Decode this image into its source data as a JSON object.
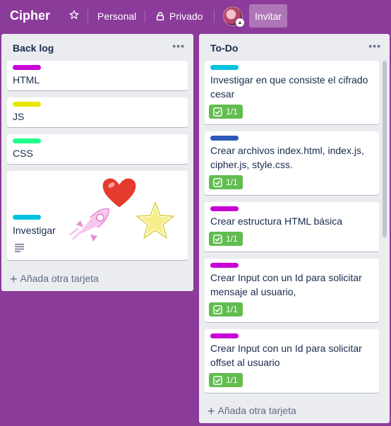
{
  "header": {
    "board_title": "Cipher",
    "star_icon": "star-icon",
    "team": "Personal",
    "visibility": "Privado",
    "invite_label": "Invitar"
  },
  "lists": [
    {
      "title": "Back log",
      "menu": "•••",
      "add_card": "Añada otra tarjeta",
      "cards": [
        {
          "label_color": "#c800d6",
          "text": "HTML"
        },
        {
          "label_color": "#e6e600",
          "text": "JS"
        },
        {
          "label_color": "#1efc8d",
          "text": "CSS"
        },
        {
          "label_color": "#00c2e0",
          "text": "Investigar",
          "stickers": [
            "rocket-sticker",
            "heart-sticker",
            "star-sticker"
          ],
          "has_description": true
        }
      ]
    },
    {
      "title": "To-Do",
      "menu": "•••",
      "add_card": "Añada otra tarjeta",
      "cards": [
        {
          "label_color": "#00c2e0",
          "text_line1": "Investigar en que consiste el cifrado",
          "text_line2": "cesar",
          "checklist": "1/1"
        },
        {
          "label_color": "#2d5ab8",
          "text_line1": "Crear archivos index.html, index.js,",
          "text_line2": "cipher.js, style.css.",
          "checklist": "1/1"
        },
        {
          "label_color": "#c800d6",
          "text_line1": "Crear estructura HTML básica",
          "checklist": "1/1"
        },
        {
          "label_color": "#c800d6",
          "text_line1": "Crear Input con un Id para solicitar",
          "text_line2": "mensaje al usuario,",
          "checklist": "1/1"
        },
        {
          "label_color": "#c800d6",
          "text_line1": "Crear Input con un Id para solicitar",
          "text_line2": "offset al usuario",
          "checklist": "1/1"
        }
      ]
    }
  ],
  "colors": {
    "board_bg": "#8b3b9a",
    "list_bg": "#ebecf0",
    "badge_green": "#61bd4f"
  }
}
